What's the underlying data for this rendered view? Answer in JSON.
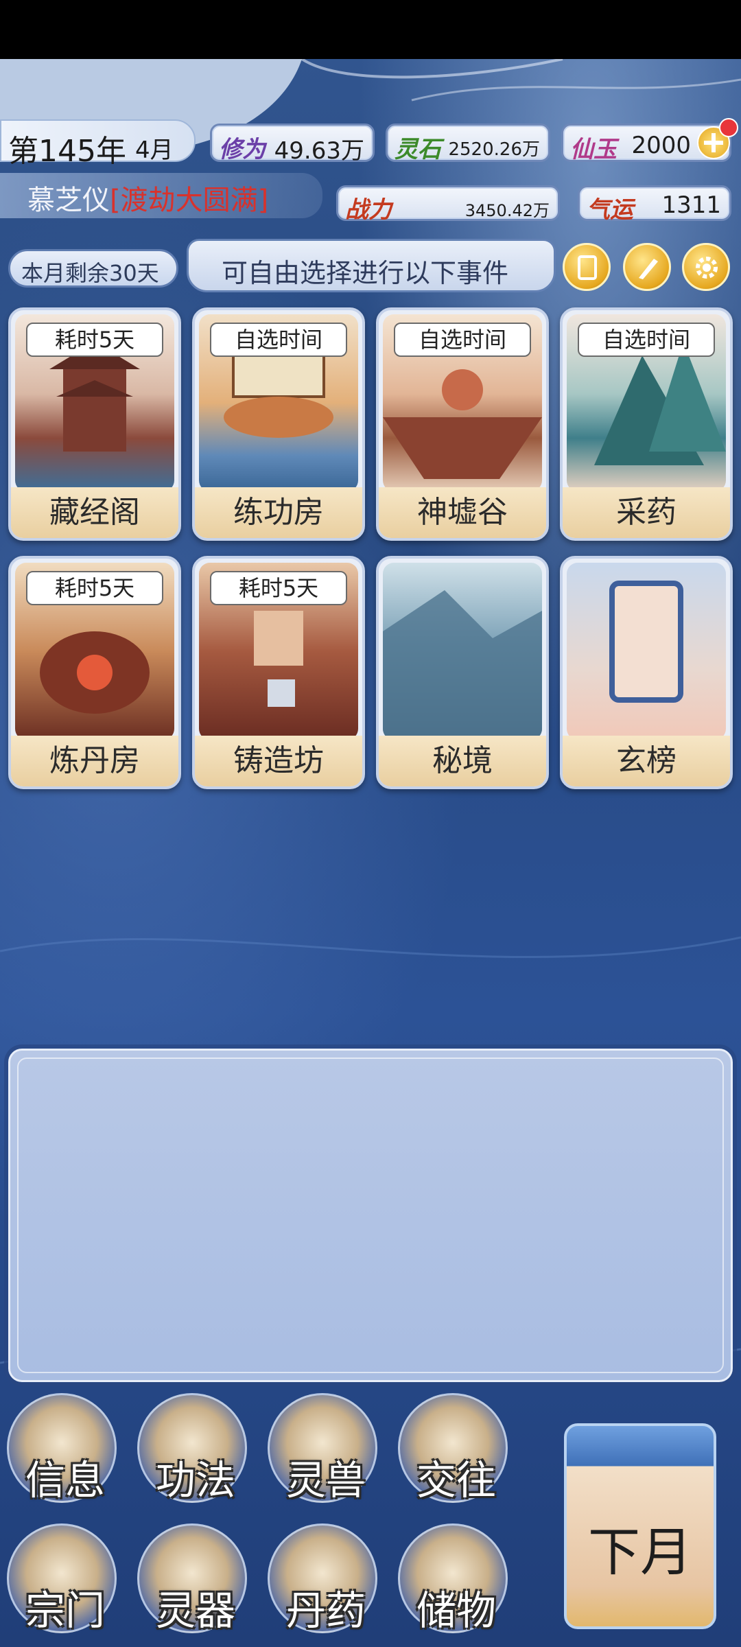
{
  "header": {
    "year_label": "第145年",
    "month_label": "4月",
    "resources": [
      {
        "name": "修为",
        "value": "49.63万",
        "color": "#6b3fa8"
      },
      {
        "name": "灵石",
        "value": "2520.26万",
        "color": "#3c8a2a"
      },
      {
        "name": "仙玉",
        "value": "2000",
        "color": "#b03a8a"
      }
    ],
    "character": {
      "name": "慕芝仪",
      "realm_prefix": "[",
      "realm": "渡劫大圆满",
      "realm_suffix": "]",
      "realm_color": "#d8322c"
    },
    "power": {
      "name": "战力",
      "value": "3450.42万"
    },
    "luck": {
      "name": "气运",
      "value": "1311"
    }
  },
  "event_bar": {
    "days_left": "本月剩余30天",
    "prompt": "可自由选择进行以下事件"
  },
  "locations": [
    {
      "label": "藏经阁",
      "tag": "耗时5天"
    },
    {
      "label": "练功房",
      "tag": "自选时间"
    },
    {
      "label": "神墟谷",
      "tag": "自选时间"
    },
    {
      "label": "采药",
      "tag": "自选时间"
    },
    {
      "label": "炼丹房",
      "tag": "耗时5天"
    },
    {
      "label": "铸造坊",
      "tag": "耗时5天"
    },
    {
      "label": "秘境",
      "tag": ""
    },
    {
      "label": "玄榜",
      "tag": ""
    }
  ],
  "menu": {
    "row1": [
      "信息",
      "功法",
      "灵兽",
      "交往"
    ],
    "row2": [
      "宗门",
      "灵器",
      "丹药",
      "储物"
    ],
    "next_month": "下月"
  }
}
